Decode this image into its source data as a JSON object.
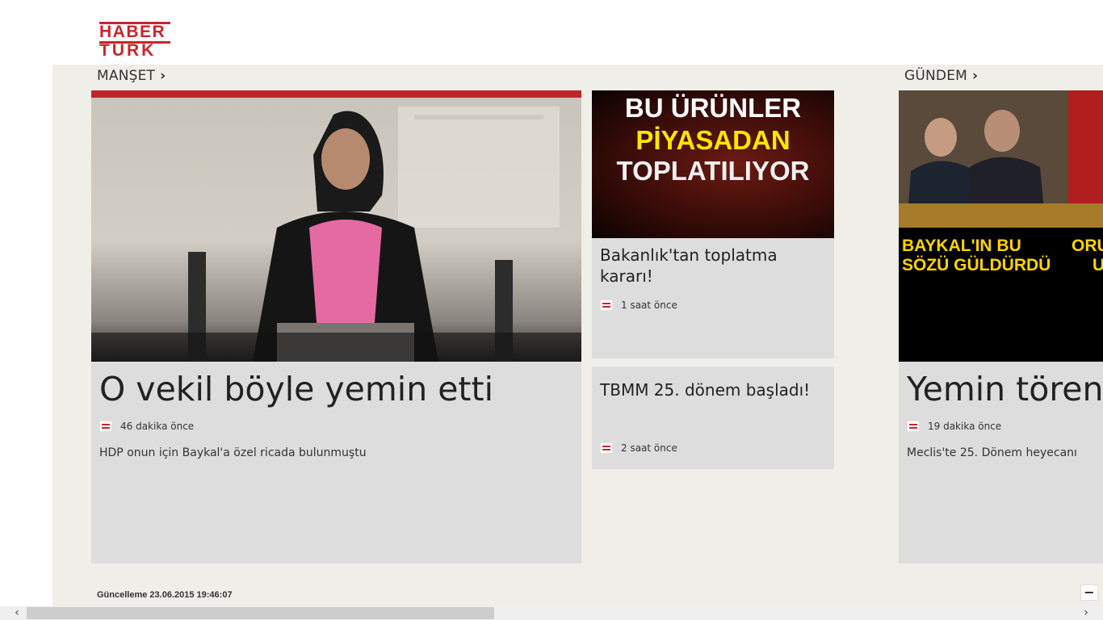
{
  "logo": {
    "line1": "HABER",
    "line2": "TURK"
  },
  "sections": {
    "manset": {
      "title": "MANŞET",
      "chevron": "›"
    },
    "gundem": {
      "title": "GÜNDEM",
      "chevron": "›"
    }
  },
  "cards": {
    "main": {
      "headline": "O vekil böyle yemin etti",
      "time": "46 dakika önce",
      "summary": "HDP onun için Baykal'a özel ricada bulunmuştu"
    },
    "side1": {
      "image_text": [
        "BU ÜRÜNLER",
        "PİYASADAN",
        "TOPLATILIYOR"
      ],
      "headline": "Bakanlık'tan toplatma kararı!",
      "time": "1 saat önce"
    },
    "side2": {
      "headline": "TBMM 25. dönem başladı!",
      "time": "2 saat önce"
    },
    "gundem": {
      "image_text": [
        "BAYKAL'IN BU",
        "SÖZÜ GÜLDÜRDÜ",
        "ORU",
        "U"
      ],
      "headline": "Yemin töreni",
      "time": "19 dakika önce",
      "summary": "Meclis'te 25. Dönem heyecanı"
    }
  },
  "footer": {
    "update": "Güncelleme 23.06.2015 19:46:07",
    "zoom": "−"
  },
  "scrollbar": {
    "left_arrow": "‹",
    "right_arrow": "›"
  },
  "colors": {
    "brand_red": "#c8262b",
    "background": "#efeee8",
    "card": "#dddddd"
  }
}
